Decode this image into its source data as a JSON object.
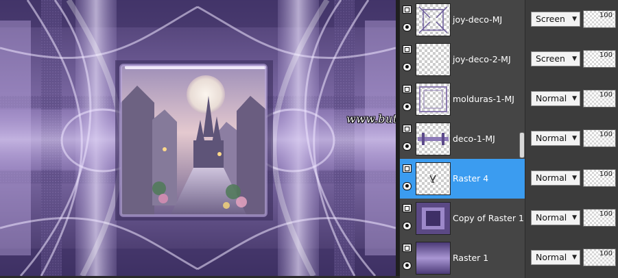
{
  "canvas": {
    "watermark_text": "www.butterfly.adv.br - Maria José",
    "colors": {
      "deep": "#3d2f60",
      "mid": "#7a65a0",
      "light": "#c9b8e6"
    }
  },
  "layers_panel": {
    "layers": [
      {
        "name": "joy-deco-MJ",
        "blend": "Screen",
        "opacity": "100",
        "selected": false,
        "thumb": "deco-x"
      },
      {
        "name": "joy-deco-2-MJ",
        "blend": "Screen",
        "opacity": "100",
        "selected": false,
        "thumb": "transparent"
      },
      {
        "name": "molduras-1-MJ",
        "blend": "Normal",
        "opacity": "100",
        "selected": false,
        "thumb": "frame-outline"
      },
      {
        "name": "deco-1-MJ",
        "blend": "Normal",
        "opacity": "100",
        "selected": false,
        "thumb": "bars"
      },
      {
        "name": "Raster 4",
        "blend": "Normal",
        "opacity": "100",
        "selected": true,
        "thumb": "small-mark"
      },
      {
        "name": "Copy of Raster 1",
        "blend": "Normal",
        "opacity": "100",
        "selected": false,
        "thumb": "frame-purple"
      },
      {
        "name": "Raster 1",
        "blend": "Normal",
        "opacity": "100",
        "selected": false,
        "thumb": "purple-fill"
      }
    ],
    "selected_color": "#3b9cf0"
  }
}
